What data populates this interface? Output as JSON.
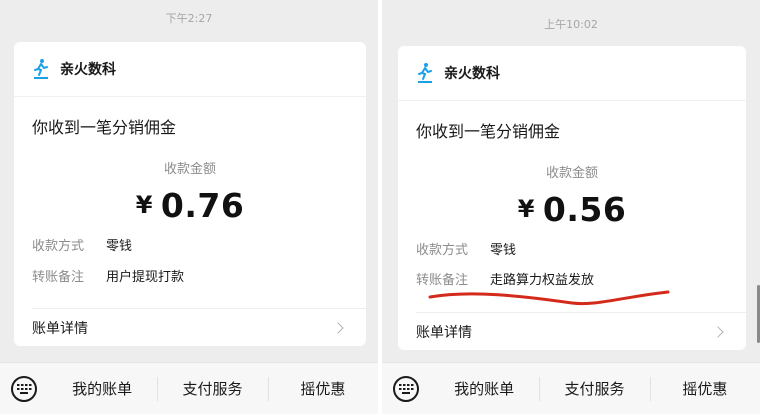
{
  "left": {
    "time": "下午2:27",
    "app_name": "亲火数科",
    "title": "你收到一笔分销佣金",
    "amount_label": "收款金额",
    "currency": "¥",
    "amount": "0.76",
    "method_label": "收款方式",
    "method_value": "零钱",
    "note_label": "转账备注",
    "note_value": "用户提现打款",
    "details_label": "账单详情"
  },
  "right": {
    "time": "上午10:02",
    "app_name": "亲火数科",
    "title": "你收到一笔分销佣金",
    "amount_label": "收款金额",
    "currency": "¥",
    "amount": "0.56",
    "method_label": "收款方式",
    "method_value": "零钱",
    "note_label": "转账备注",
    "note_value": "走路算力权益发放",
    "details_label": "账单详情"
  },
  "bottom_menu": {
    "items": [
      "我的账单",
      "支付服务",
      "摇优惠"
    ]
  },
  "icons": {
    "logo": "running-person-icon",
    "details": "chevron-right-icon",
    "keyboard": "keyboard-icon"
  },
  "colors": {
    "logo": "#1aa0e8",
    "annotation": "#d42a1c"
  }
}
